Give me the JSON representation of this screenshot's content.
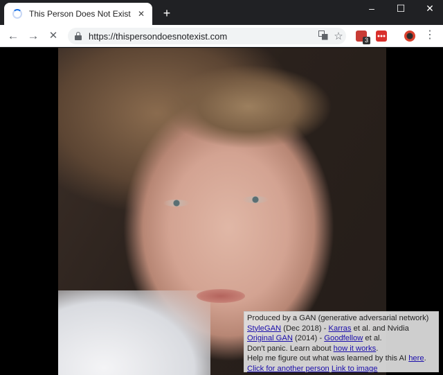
{
  "tab": {
    "title": "This Person Does Not Exist",
    "close_symbol": "✕"
  },
  "window_controls": [
    "–",
    "☐",
    "✕"
  ],
  "nav": {
    "back_symbol": "←",
    "forward_symbol": "→",
    "stop_symbol": "✕",
    "new_tab_symbol": "+"
  },
  "omnibox": {
    "url": "https://thispersondoesnotexist.com"
  },
  "extensions": {
    "badge_count": "3"
  },
  "menu_symbol": "⋮",
  "caption": {
    "line1": "Produced by a GAN (generative adversarial network)",
    "stylegan_link": "StyleGAN",
    "stylegan_date": " (Dec 2018) - ",
    "karras_link": "Karras",
    "karras_suffix": " et al. and Nvidia",
    "original_gan_link": "Original GAN",
    "original_gan_date": " (2014) - ",
    "goodfellow_link": "Goodfellow",
    "goodfellow_suffix": " et al.",
    "dont_panic_prefix": "Don't panic. Learn about ",
    "how_it_works_link": "how it works",
    "dont_panic_suffix": ".",
    "help_prefix": "Help me figure out what was learned by this AI ",
    "here_link": "here",
    "help_suffix": ".",
    "another_person_link": "Click for another person",
    "link_to_image": "Link to image"
  },
  "colors": {
    "tab_strip": "#202124",
    "link": "#1a0dab",
    "spinner": "#1a73e8"
  }
}
